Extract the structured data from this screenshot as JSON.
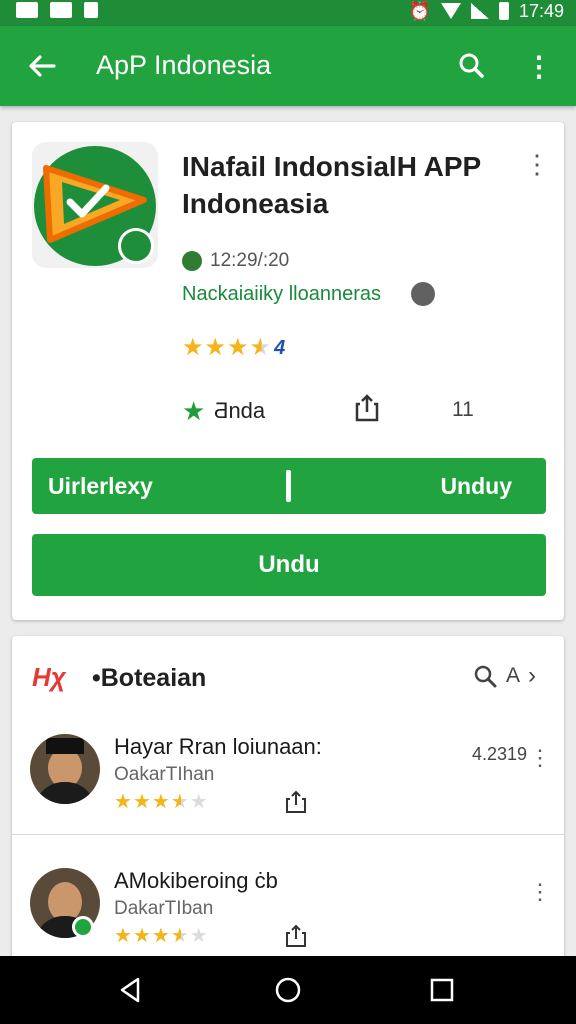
{
  "status_bar": {
    "time": "17:49",
    "alarm_icon": "alarm-icon",
    "wifi_icon": "wifi-icon",
    "signal_icon": "signal-icon",
    "battery_icon": "battery-icon"
  },
  "app_bar": {
    "title": "ApP Indonesia",
    "back_icon": "arrow-back-icon",
    "search_icon": "search-icon",
    "more_icon": "more-vert-icon"
  },
  "app": {
    "title": "INafail Indonsial​H APP Indoneasia",
    "date": "12:29/:20",
    "developer": "Nackaiaiiky lloanneras",
    "rating_value": "4",
    "rating_stars": 4.5,
    "stat_label": "Ƌnda",
    "stat_count": "11",
    "button_left": "Uirlerlexy",
    "button_right": "Unduy",
    "button_main": "Undu",
    "colors": {
      "primary": "#21a33f",
      "status_bar": "#1f8d38",
      "star": "#f4b41a",
      "link": "#1a8a3a"
    }
  },
  "section": {
    "logo_text": "Hχ",
    "title": "•Boteaian",
    "action_label": "A",
    "items": [
      {
        "name": "Hayar Rran loiunaan:",
        "sub": "OakarTIhan",
        "meta": "4.2319",
        "stars": 3.5
      },
      {
        "name": "AMokiberoing ċb",
        "sub": "DakarTIban",
        "meta": "",
        "stars": 3.5
      }
    ]
  },
  "nav_bar": {
    "back_icon": "nav-back-icon",
    "home_icon": "nav-home-icon",
    "recents_icon": "nav-recents-icon"
  }
}
